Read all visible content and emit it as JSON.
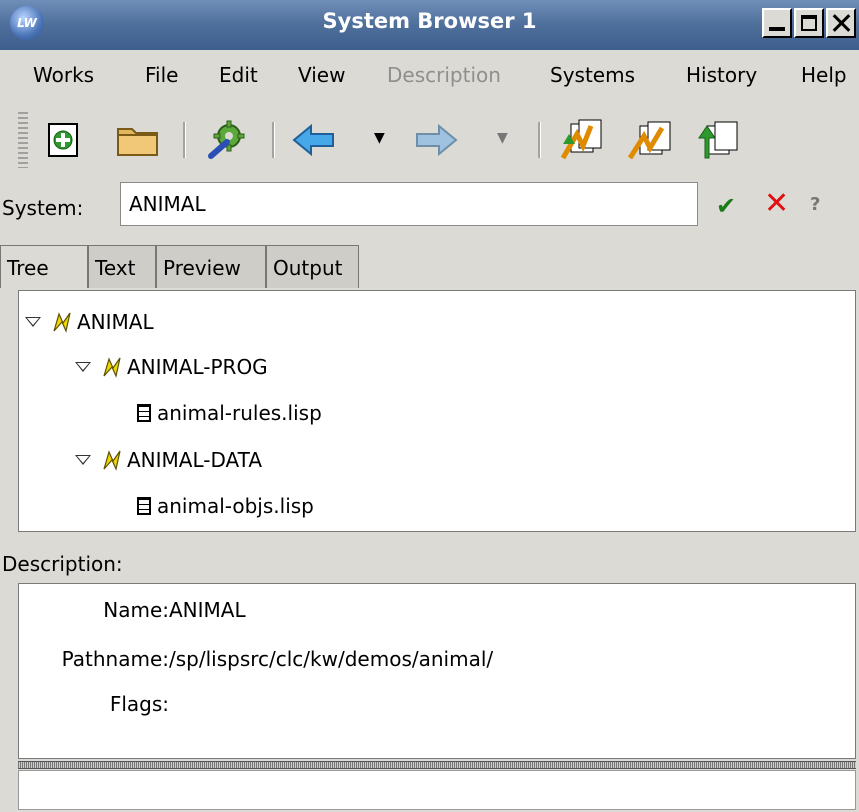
{
  "window": {
    "title": "System Browser 1",
    "logo": "LW"
  },
  "menu": [
    "Works",
    "File",
    "Edit",
    "View",
    "Description",
    "Systems",
    "History",
    "Help"
  ],
  "menu_disabled": [
    "Description"
  ],
  "toolbar": {
    "icons": [
      "new-icon",
      "open-folder-icon",
      "gear-wrench-icon",
      "back-arrow-icon",
      "forward-arrow-icon",
      "compile-system-icon",
      "load-system-icon",
      "compile-and-load-icon"
    ]
  },
  "system": {
    "label": "System:",
    "value": "ANIMAL"
  },
  "tabs": [
    "Tree",
    "Text",
    "Preview",
    "Output"
  ],
  "tree": [
    {
      "label": "ANIMAL",
      "kind": "system"
    },
    {
      "label": "ANIMAL-PROG",
      "kind": "system"
    },
    {
      "label": "animal-rules.lisp",
      "kind": "file"
    },
    {
      "label": "ANIMAL-DATA",
      "kind": "system"
    },
    {
      "label": "animal-objs.lisp",
      "kind": "file"
    }
  ],
  "description": {
    "label": "Description:",
    "name_key": "Name:",
    "name_value": "ANIMAL",
    "path_key": "Pathname:",
    "path_value": "/sp/lispsrc/clc/kw/demos/animal/",
    "flags_key": "Flags:",
    "flags_value": ""
  },
  "colors": {
    "titlebar": "#4f6f9b",
    "accept": "#1a7d1a",
    "cancel": "#e01010",
    "system_icon": "#f2d600"
  }
}
